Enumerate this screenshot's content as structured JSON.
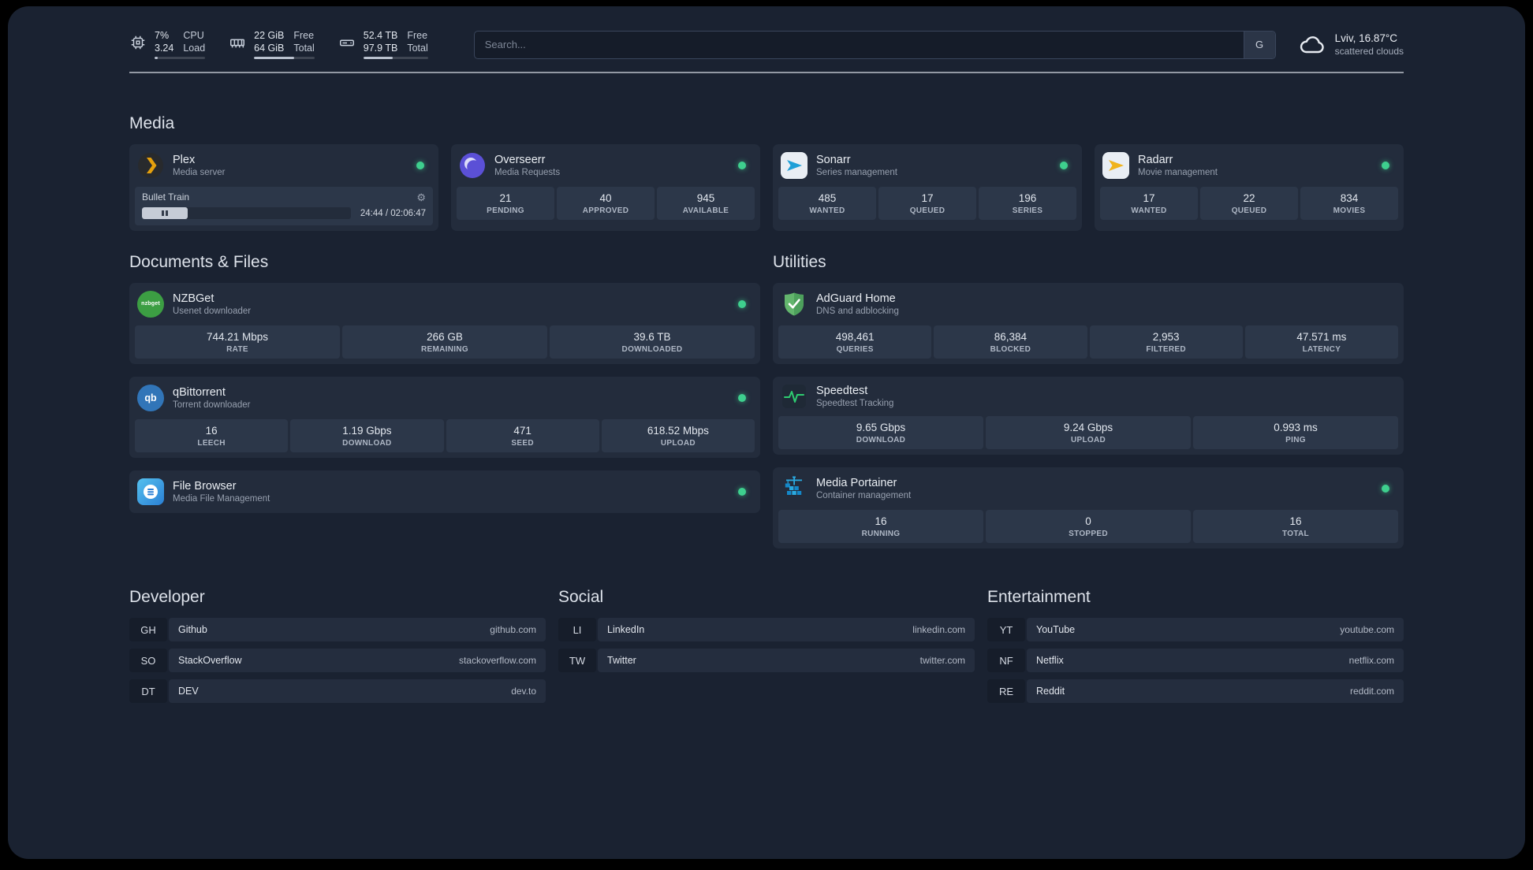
{
  "topbar": {
    "resources": [
      {
        "icon": "cpu-icon",
        "values": [
          "7%",
          "3.24"
        ],
        "labels": [
          "CPU",
          "Load"
        ],
        "percent": 7
      },
      {
        "icon": "memory-icon",
        "values": [
          "22 GiB",
          "64 GiB"
        ],
        "labels": [
          "Free",
          "Total"
        ],
        "percent": 66
      },
      {
        "icon": "disk-icon",
        "values": [
          "52.4 TB",
          "97.9 TB"
        ],
        "labels": [
          "Free",
          "Total"
        ],
        "percent": 46
      }
    ],
    "search": {
      "placeholder": "Search...",
      "provider_label": "G"
    },
    "weather": {
      "location": "Lviv, 16.87°C",
      "condition": "scattered clouds"
    }
  },
  "sections": {
    "media": {
      "title": "Media",
      "services": [
        {
          "name": "Plex",
          "description": "Media server",
          "status": "online",
          "player": {
            "title": "Bullet Train",
            "time": "24:44 / 02:06:47"
          }
        },
        {
          "name": "Overseerr",
          "description": "Media Requests",
          "status": "online",
          "stats": [
            {
              "value": "21",
              "label": "PENDING"
            },
            {
              "value": "40",
              "label": "APPROVED"
            },
            {
              "value": "945",
              "label": "AVAILABLE"
            }
          ]
        },
        {
          "name": "Sonarr",
          "description": "Series management",
          "status": "online",
          "stats": [
            {
              "value": "485",
              "label": "WANTED"
            },
            {
              "value": "17",
              "label": "QUEUED"
            },
            {
              "value": "196",
              "label": "SERIES"
            }
          ]
        },
        {
          "name": "Radarr",
          "description": "Movie management",
          "status": "online",
          "stats": [
            {
              "value": "17",
              "label": "WANTED"
            },
            {
              "value": "22",
              "label": "QUEUED"
            },
            {
              "value": "834",
              "label": "MOVIES"
            }
          ]
        }
      ]
    },
    "documents": {
      "title": "Documents & Files",
      "services": [
        {
          "name": "NZBGet",
          "description": "Usenet downloader",
          "status": "online",
          "stats": [
            {
              "value": "744.21 Mbps",
              "label": "RATE"
            },
            {
              "value": "266 GB",
              "label": "REMAINING"
            },
            {
              "value": "39.6 TB",
              "label": "DOWNLOADED"
            }
          ]
        },
        {
          "name": "qBittorrent",
          "description": "Torrent downloader",
          "status": "online",
          "stats": [
            {
              "value": "16",
              "label": "LEECH"
            },
            {
              "value": "1.19 Gbps",
              "label": "DOWNLOAD"
            },
            {
              "value": "471",
              "label": "SEED"
            },
            {
              "value": "618.52 Mbps",
              "label": "UPLOAD"
            }
          ]
        },
        {
          "name": "File Browser",
          "description": "Media File Management",
          "status": "online"
        }
      ]
    },
    "utilities": {
      "title": "Utilities",
      "services": [
        {
          "name": "AdGuard Home",
          "description": "DNS and adblocking",
          "stats": [
            {
              "value": "498,461",
              "label": "QUERIES"
            },
            {
              "value": "86,384",
              "label": "BLOCKED"
            },
            {
              "value": "2,953",
              "label": "FILTERED"
            },
            {
              "value": "47.571 ms",
              "label": "LATENCY"
            }
          ]
        },
        {
          "name": "Speedtest",
          "description": "Speedtest Tracking",
          "stats": [
            {
              "value": "9.65 Gbps",
              "label": "DOWNLOAD"
            },
            {
              "value": "9.24 Gbps",
              "label": "UPLOAD"
            },
            {
              "value": "0.993 ms",
              "label": "PING"
            }
          ]
        },
        {
          "name": "Media Portainer",
          "description": "Container management",
          "status": "online",
          "stats": [
            {
              "value": "16",
              "label": "RUNNING"
            },
            {
              "value": "0",
              "label": "STOPPED"
            },
            {
              "value": "16",
              "label": "TOTAL"
            }
          ]
        }
      ]
    }
  },
  "bookmarks": [
    {
      "title": "Developer",
      "items": [
        {
          "abbr": "GH",
          "name": "Github",
          "url": "github.com"
        },
        {
          "abbr": "SO",
          "name": "StackOverflow",
          "url": "stackoverflow.com"
        },
        {
          "abbr": "DT",
          "name": "DEV",
          "url": "dev.to"
        }
      ]
    },
    {
      "title": "Social",
      "items": [
        {
          "abbr": "LI",
          "name": "LinkedIn",
          "url": "linkedin.com"
        },
        {
          "abbr": "TW",
          "name": "Twitter",
          "url": "twitter.com"
        }
      ]
    },
    {
      "title": "Entertainment",
      "items": [
        {
          "abbr": "YT",
          "name": "YouTube",
          "url": "youtube.com"
        },
        {
          "abbr": "NF",
          "name": "Netflix",
          "url": "netflix.com"
        },
        {
          "abbr": "RE",
          "name": "Reddit",
          "url": "reddit.com"
        }
      ]
    }
  ],
  "colors": {
    "status_online": "#3ecf8e",
    "accent_plex": "#e5a00d",
    "accent_sonarr": "#1e9fd8",
    "accent_radarr": "#f0b31c"
  }
}
